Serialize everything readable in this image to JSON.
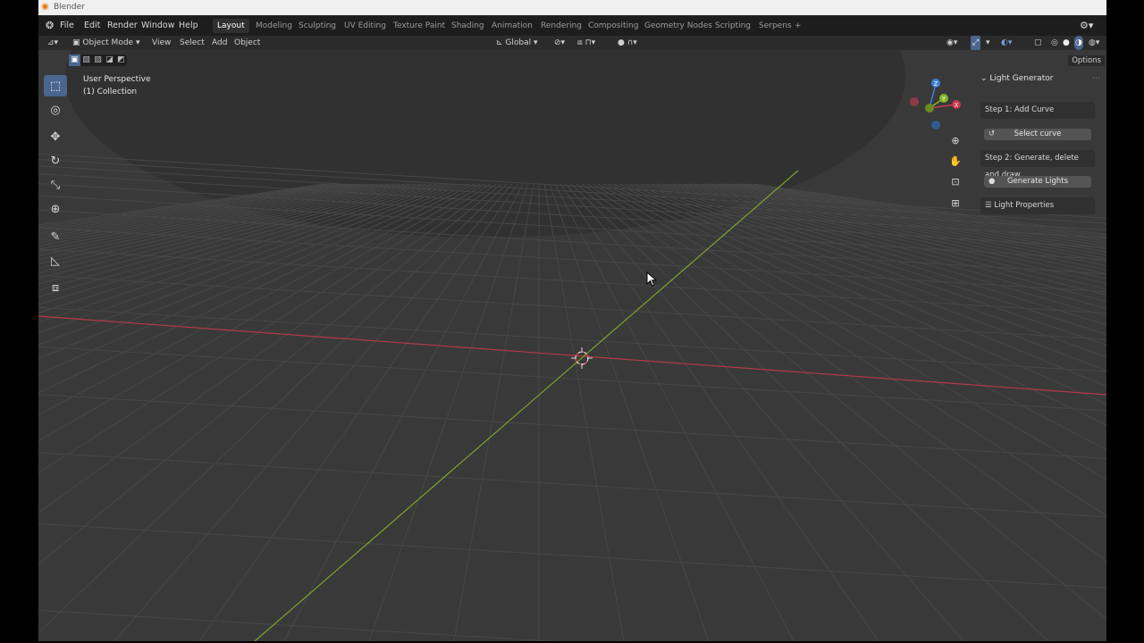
{
  "window": {
    "title": "Blender"
  },
  "menu": [
    "File",
    "Edit",
    "Render",
    "Window",
    "Help"
  ],
  "workspaces": [
    "Layout",
    "Modeling",
    "Sculpting",
    "UV Editing",
    "Texture Paint",
    "Shading",
    "Animation",
    "Rendering",
    "Compositing",
    "Geometry Nodes",
    "Scripting",
    "Serpens",
    "+"
  ],
  "workspace_active": "Layout",
  "header": {
    "mode": "Object Mode",
    "menus": [
      "View",
      "Select",
      "Add",
      "Object"
    ],
    "transform_orientation": "Global"
  },
  "viewport": {
    "perspective": "User Perspective",
    "collection": "(1) Collection",
    "options_label": "Options"
  },
  "gizmo": {
    "x": "X",
    "y": "Y",
    "z": "Z"
  },
  "panel": {
    "title": "Light Generator",
    "step1": "Step 1: Add Curve",
    "select_curve": "Select curve",
    "step2": "Step 2: Generate, delete and draw",
    "generate": "Generate Lights",
    "properties": "Light Properties"
  },
  "colors": {
    "accent": "#4a6690",
    "x_axis": "#c8394a",
    "y_axis": "#82b523",
    "z_axis": "#3b7fd6"
  }
}
